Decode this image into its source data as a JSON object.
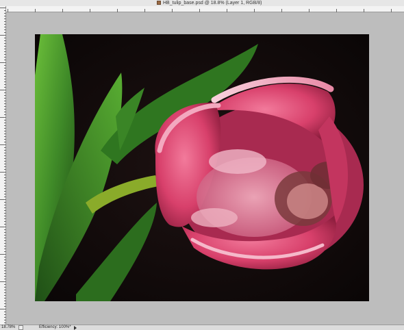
{
  "window": {
    "title": "HB_tulip_base.psd @ 18.8% (Layer 1, RGB/8)"
  },
  "status": {
    "zoom": "18.78%",
    "efficiency": "Efficiency: 100%*"
  },
  "icons": {
    "document": "document-icon",
    "navigator": "navigator-icon",
    "status_menu": "play-arrow-icon"
  },
  "colors": {
    "canvas_bg": "#bdbdbd",
    "photo_bg": "#0f0909",
    "tulip": "#d8406b",
    "leaf": "#3f8a28"
  }
}
